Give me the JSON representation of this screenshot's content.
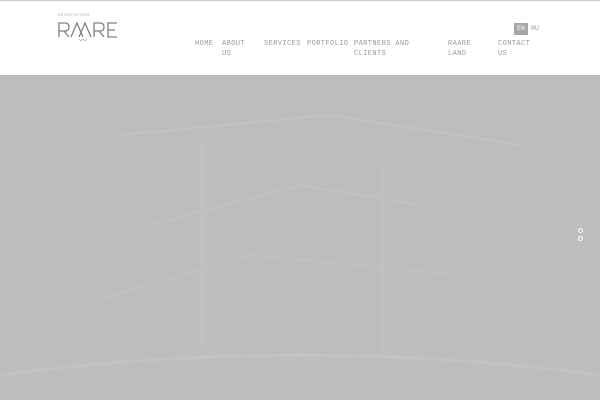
{
  "brand": {
    "tagline": "ARCHITECTURE",
    "logo_text": "RAARE"
  },
  "nav": {
    "items": [
      {
        "label": "HOME"
      },
      {
        "label": "ABOUT US"
      },
      {
        "label": "SERVICES"
      },
      {
        "label": "PORTFOLIO"
      },
      {
        "label": "PARTNERS AND CLIENTS"
      },
      {
        "label": "RAARE LAND"
      },
      {
        "label": "CONTACT US"
      }
    ]
  },
  "languages": {
    "active": "EN",
    "other": "RU"
  },
  "colors": {
    "hero_bg": "#bcbcbc",
    "nav_text": "#9a9a9a",
    "active_lang_bg": "#a6a6a6"
  },
  "slider": {
    "slide_count": 2
  }
}
